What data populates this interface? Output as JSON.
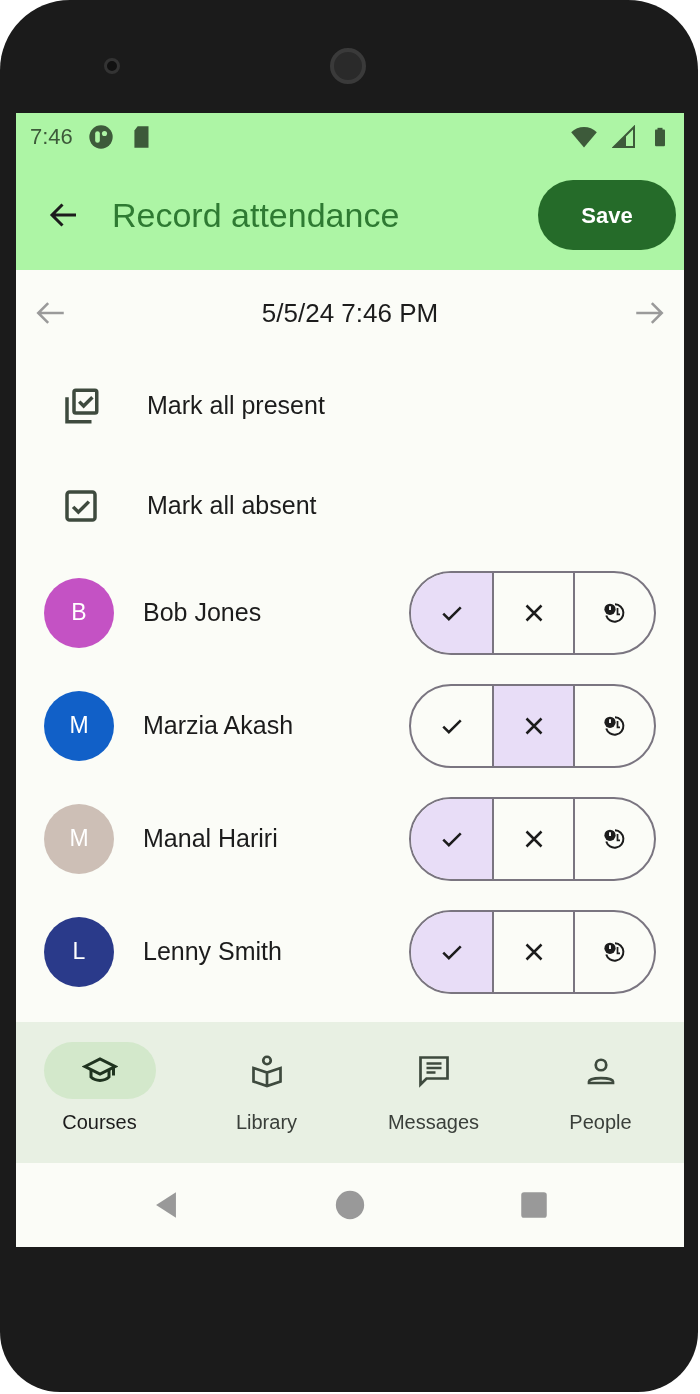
{
  "status_bar": {
    "time": "7:46"
  },
  "app_bar": {
    "title": "Record attendance",
    "action": "Save"
  },
  "date_nav": {
    "date": "5/5/24 7:46 PM"
  },
  "bulk_actions": [
    {
      "kind": "all-present",
      "label": "Mark all present"
    },
    {
      "kind": "all-absent",
      "label": "Mark all absent"
    }
  ],
  "students": [
    {
      "initial": "B",
      "name": "Bob Jones",
      "color": "#c452c4",
      "options": [
        {
          "kind": "present",
          "selected": true
        },
        {
          "kind": "absent",
          "selected": false
        },
        {
          "kind": "late",
          "selected": false
        }
      ]
    },
    {
      "initial": "M",
      "name": "Marzia Akash",
      "color": "#1160c8",
      "options": [
        {
          "kind": "present",
          "selected": false
        },
        {
          "kind": "absent",
          "selected": true
        },
        {
          "kind": "late",
          "selected": false
        }
      ]
    },
    {
      "initial": "M",
      "name": "Manal Hariri",
      "color": "#cdbfb6",
      "options": [
        {
          "kind": "present",
          "selected": true
        },
        {
          "kind": "absent",
          "selected": false
        },
        {
          "kind": "late",
          "selected": false
        }
      ]
    },
    {
      "initial": "L",
      "name": "Lenny Smith",
      "color": "#2a3a8a",
      "options": [
        {
          "kind": "present",
          "selected": true
        },
        {
          "kind": "absent",
          "selected": false
        },
        {
          "kind": "late",
          "selected": false
        }
      ]
    }
  ],
  "bottom_nav": [
    {
      "kind": "courses",
      "label": "Courses",
      "selected": true
    },
    {
      "kind": "library",
      "label": "Library",
      "selected": false
    },
    {
      "kind": "messages",
      "label": "Messages",
      "selected": false
    },
    {
      "kind": "people",
      "label": "People",
      "selected": false
    }
  ]
}
